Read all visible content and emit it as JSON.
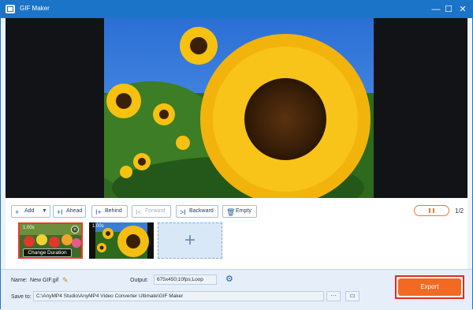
{
  "window": {
    "title": "GIF Maker",
    "minimize_glyph": "—",
    "maximize_glyph": "☐",
    "close_glyph": "✕"
  },
  "toolbar": {
    "add": "Add",
    "ahead": "Ahead",
    "behind": "Behind",
    "forward": "Forward",
    "backward": "Backward",
    "empty": "Empty",
    "page_counter": "1/2"
  },
  "frames": [
    {
      "duration": "1.00s",
      "action": "Change Duration",
      "selected": true
    },
    {
      "duration": "1.00s",
      "selected": false
    }
  ],
  "settings": {
    "name_label": "Name:",
    "name_value": "New GIF.gif",
    "output_label": "Output:",
    "output_value": "675x450;10fps;Loop",
    "save_label": "Save to:",
    "save_path": "C:\\AnyMP4 Studio\\AnyMP4 Video Converter Ultimate\\GIF Maker",
    "browse_label": "···"
  },
  "export_label": "Export",
  "colors": {
    "accent": "#1b74c7",
    "export": "#f26a21",
    "highlight": "#e02a1e"
  },
  "icons": [
    "app-icon",
    "add-icon",
    "dropdown-icon",
    "ahead-icon",
    "behind-icon",
    "forward-icon",
    "backward-icon",
    "trash-icon",
    "pause-icon",
    "close-icon",
    "edit-icon",
    "gear-icon",
    "folder-icon",
    "plus-icon"
  ]
}
